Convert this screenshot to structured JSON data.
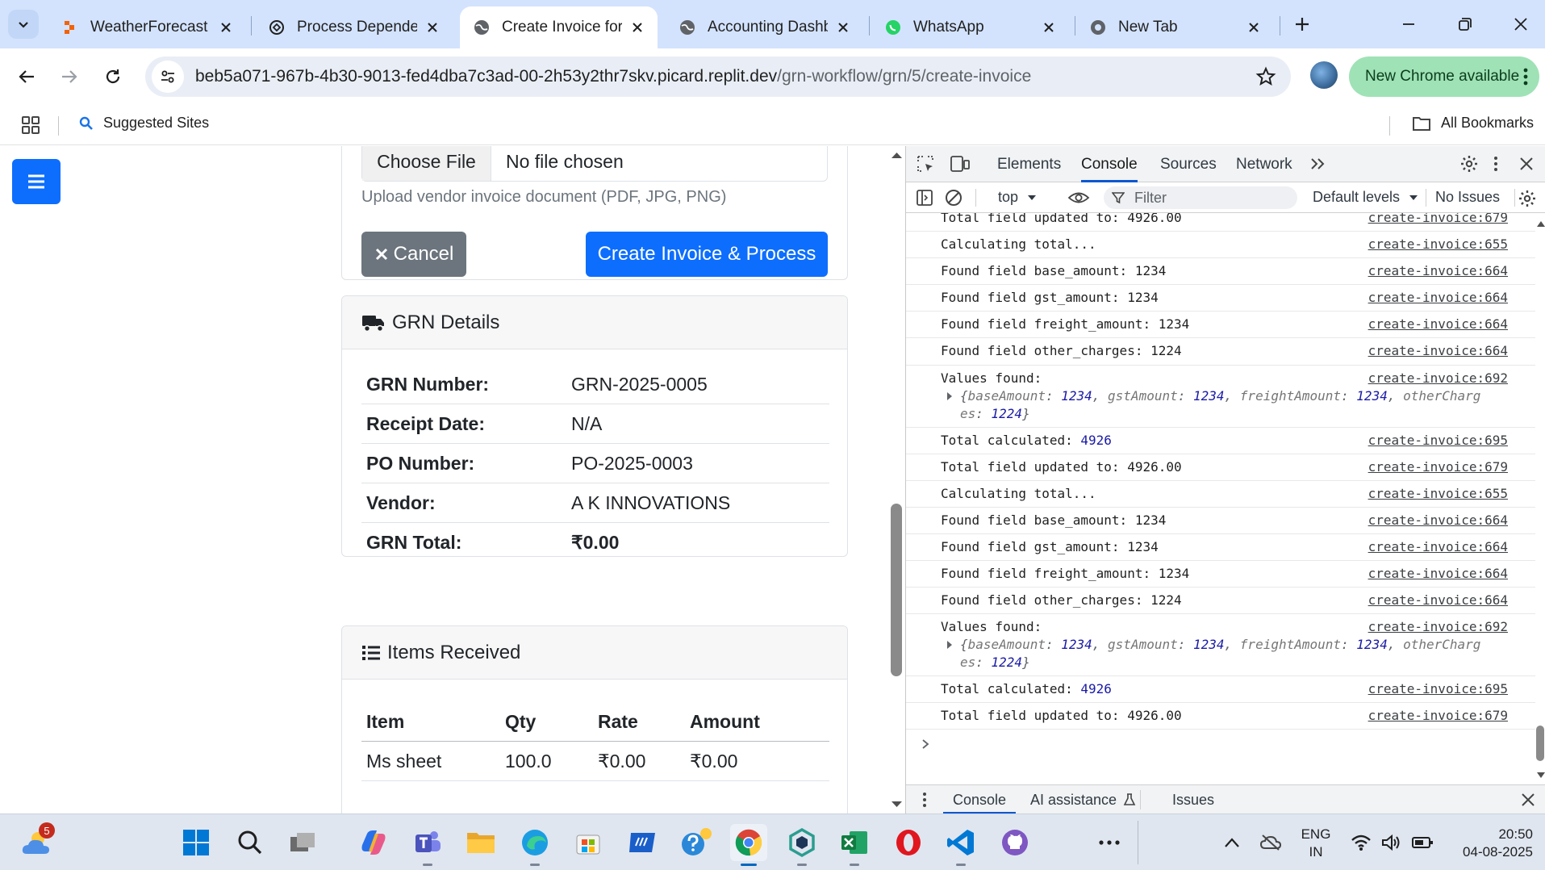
{
  "browser": {
    "tabs": [
      {
        "title": "WeatherForecast -",
        "icon": "replit-icon"
      },
      {
        "title": "Process Dependen",
        "icon": "chatgpt-icon"
      },
      {
        "title": "Create Invoice for",
        "icon": "globe-icon",
        "active": true
      },
      {
        "title": "Accounting Dashb",
        "icon": "globe-icon"
      },
      {
        "title": "WhatsApp",
        "icon": "whatsapp-icon"
      },
      {
        "title": "New Tab",
        "icon": "chrome-icon"
      }
    ],
    "url_host": "beb5a071-967b-4b30-9013-fed4dba7c3ad-00-2h53y2thr7skv.picard.replit.dev",
    "url_path": "/grn-workflow/grn/5/create-invoice",
    "update_label": "New Chrome available",
    "bookmarks": {
      "suggested": "Suggested Sites",
      "all": "All Bookmarks"
    }
  },
  "page": {
    "file_input": {
      "button": "Choose File",
      "status": "No file chosen"
    },
    "file_help": "Upload vendor invoice document (PDF, JPG, PNG)",
    "cancel_label": "Cancel",
    "create_label": "Create Invoice & Process",
    "grn_details": {
      "title": "GRN Details",
      "rows": [
        {
          "label": "GRN Number:",
          "value": "GRN-2025-0005"
        },
        {
          "label": "Receipt Date:",
          "value": "N/A"
        },
        {
          "label": "PO Number:",
          "value": "PO-2025-0003"
        },
        {
          "label": "Vendor:",
          "value": "A K INNOVATIONS"
        },
        {
          "label": "GRN Total:",
          "value": "₹0.00"
        }
      ]
    },
    "items_received": {
      "title": "Items Received",
      "columns": [
        "Item",
        "Qty",
        "Rate",
        "Amount"
      ],
      "rows": [
        [
          "Ms sheet",
          "100.0",
          "₹0.00",
          "₹0.00"
        ]
      ]
    }
  },
  "devtools": {
    "tabs": [
      "Elements",
      "Console",
      "Sources",
      "Network"
    ],
    "active_tab": "Console",
    "context": "top",
    "filter_placeholder": "Filter",
    "levels": "Default levels",
    "issues": "No Issues",
    "logs": [
      {
        "msg": "Total field updated to: 4926.00",
        "src": "create-invoice:679"
      },
      {
        "msg": "Calculating total...",
        "src": "create-invoice:655"
      },
      {
        "msg": "Found field base_amount: 1234",
        "src": "create-invoice:664"
      },
      {
        "msg": "Found field gst_amount: 1234",
        "src": "create-invoice:664"
      },
      {
        "msg": "Found field freight_amount: 1234",
        "src": "create-invoice:664"
      },
      {
        "msg": "Found field other_charges: 1224",
        "src": "create-invoice:664"
      },
      {
        "msg": "Values found:",
        "src": "create-invoice:692",
        "obj_line1": [
          "baseAmount",
          "1234",
          "gstAmount",
          "1234",
          "freightAmount",
          "1234",
          "otherCharg"
        ],
        "obj_line2": [
          "es",
          "1224"
        ]
      },
      {
        "msg_prefix": "Total calculated: ",
        "msg_num": "4926",
        "src": "create-invoice:695"
      },
      {
        "msg": "Total field updated to: 4926.00",
        "src": "create-invoice:679"
      },
      {
        "msg": "Calculating total...",
        "src": "create-invoice:655"
      },
      {
        "msg": "Found field base_amount: 1234",
        "src": "create-invoice:664"
      },
      {
        "msg": "Found field gst_amount: 1234",
        "src": "create-invoice:664"
      },
      {
        "msg": "Found field freight_amount: 1234",
        "src": "create-invoice:664"
      },
      {
        "msg": "Found field other_charges: 1224",
        "src": "create-invoice:664"
      },
      {
        "msg": "Values found:",
        "src": "create-invoice:692",
        "obj_line1": [
          "baseAmount",
          "1234",
          "gstAmount",
          "1234",
          "freightAmount",
          "1234",
          "otherCharg"
        ],
        "obj_line2": [
          "es",
          "1224"
        ]
      },
      {
        "msg_prefix": "Total calculated: ",
        "msg_num": "4926",
        "src": "create-invoice:695"
      },
      {
        "msg": "Total field updated to: 4926.00",
        "src": "create-invoice:679"
      }
    ],
    "drawer_tabs": [
      "Console",
      "AI assistance",
      "Issues"
    ]
  },
  "taskbar": {
    "weather_badge": "5",
    "lang": "ENG",
    "region": "IN",
    "time": "20:50",
    "date": "04-08-2025"
  },
  "colors": {
    "primary": "#0d6efd",
    "secondary": "#6c757d",
    "tabstrip": "#d3e3fd",
    "chrome_update": "#9fe2b6",
    "devtools_accent": "#0b57d0"
  }
}
